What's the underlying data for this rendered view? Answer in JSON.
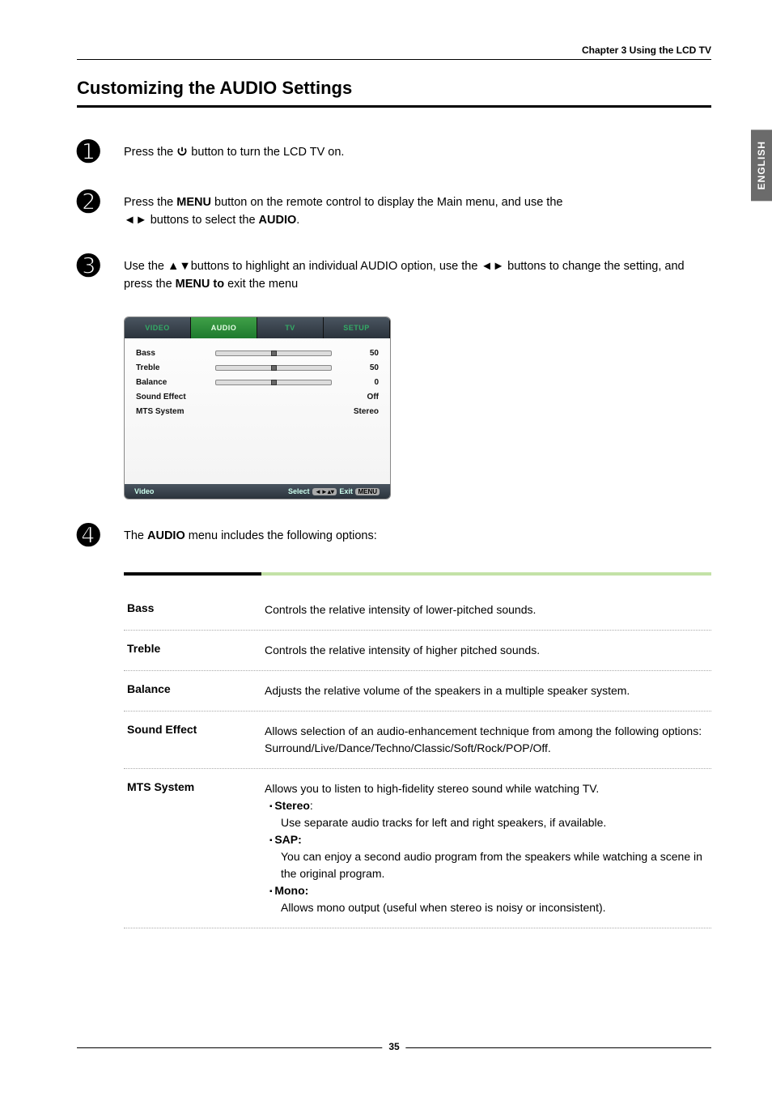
{
  "chapter_header": "Chapter 3 Using the LCD TV",
  "side_tab": "ENGLISH",
  "title": "Customizing the AUDIO Settings",
  "steps": {
    "s1": {
      "num": "➊",
      "pre": "Press the ",
      "post": " button to turn the LCD TV on."
    },
    "s2": {
      "num": "➋",
      "line1a": "Press the ",
      "line1b": "MENU",
      "line1c": " button on the remote control to display the Main menu, and use the ",
      "line2a": "◄► ",
      "line2b": "buttons to select the ",
      "line2c": "AUDIO",
      "line2d": "."
    },
    "s3": {
      "num": "➌",
      "a": "Use the ▲▼buttons to highlight an individual AUDIO option, use the ◄► buttons to change the setting, and press the ",
      "b": "MENU to",
      "c": " exit the menu"
    },
    "s4": {
      "num": "➍",
      "a": "The ",
      "b": "AUDIO",
      "c": " menu includes the following options:"
    }
  },
  "osd": {
    "tabs": [
      "VIDEO",
      "AUDIO",
      "TV",
      "SETUP"
    ],
    "rows": [
      {
        "label": "Bass",
        "value": "50",
        "slider": true
      },
      {
        "label": "Treble",
        "value": "50",
        "slider": true
      },
      {
        "label": "Balance",
        "value": "0",
        "slider": true
      },
      {
        "label": "Sound Effect",
        "value": "Off",
        "slider": false
      },
      {
        "label": "MTS System",
        "value": "Stereo",
        "slider": false
      }
    ],
    "footer_left": "Video",
    "footer_right_select": "Select",
    "footer_right_exit": "Exit",
    "footer_key_arrows": "◄►▴▾",
    "footer_key_menu": "MENU"
  },
  "options": [
    {
      "label": "Bass",
      "desc": "Controls the relative intensity of lower-pitched sounds."
    },
    {
      "label": "Treble",
      "desc": "Controls the relative intensity of higher pitched sounds."
    },
    {
      "label": "Balance",
      "desc": "Adjusts the relative volume of the speakers in a multiple speaker system."
    },
    {
      "label": "Sound Effect",
      "desc": "Allows selection of an audio-enhancement technique from among the following options: Surround/Live/Dance/Techno/Classic/Soft/Rock/POP/Off."
    },
    {
      "label": "MTS System",
      "desc_lead": "Allows you to listen to high-fidelity stereo sound while watching TV.",
      "bullets": [
        {
          "h": "Stereo",
          "t": ": ",
          "d": "Use separate audio tracks for left and right speakers, if available."
        },
        {
          "h": "SAP:",
          "t": "",
          "d": "You can enjoy a second audio program from the speakers while watching a scene in the original program."
        },
        {
          "h": "Mono:",
          "t": "",
          "d": "Allows mono output (useful when stereo is noisy or inconsistent)."
        }
      ]
    }
  ],
  "page_number": "35"
}
